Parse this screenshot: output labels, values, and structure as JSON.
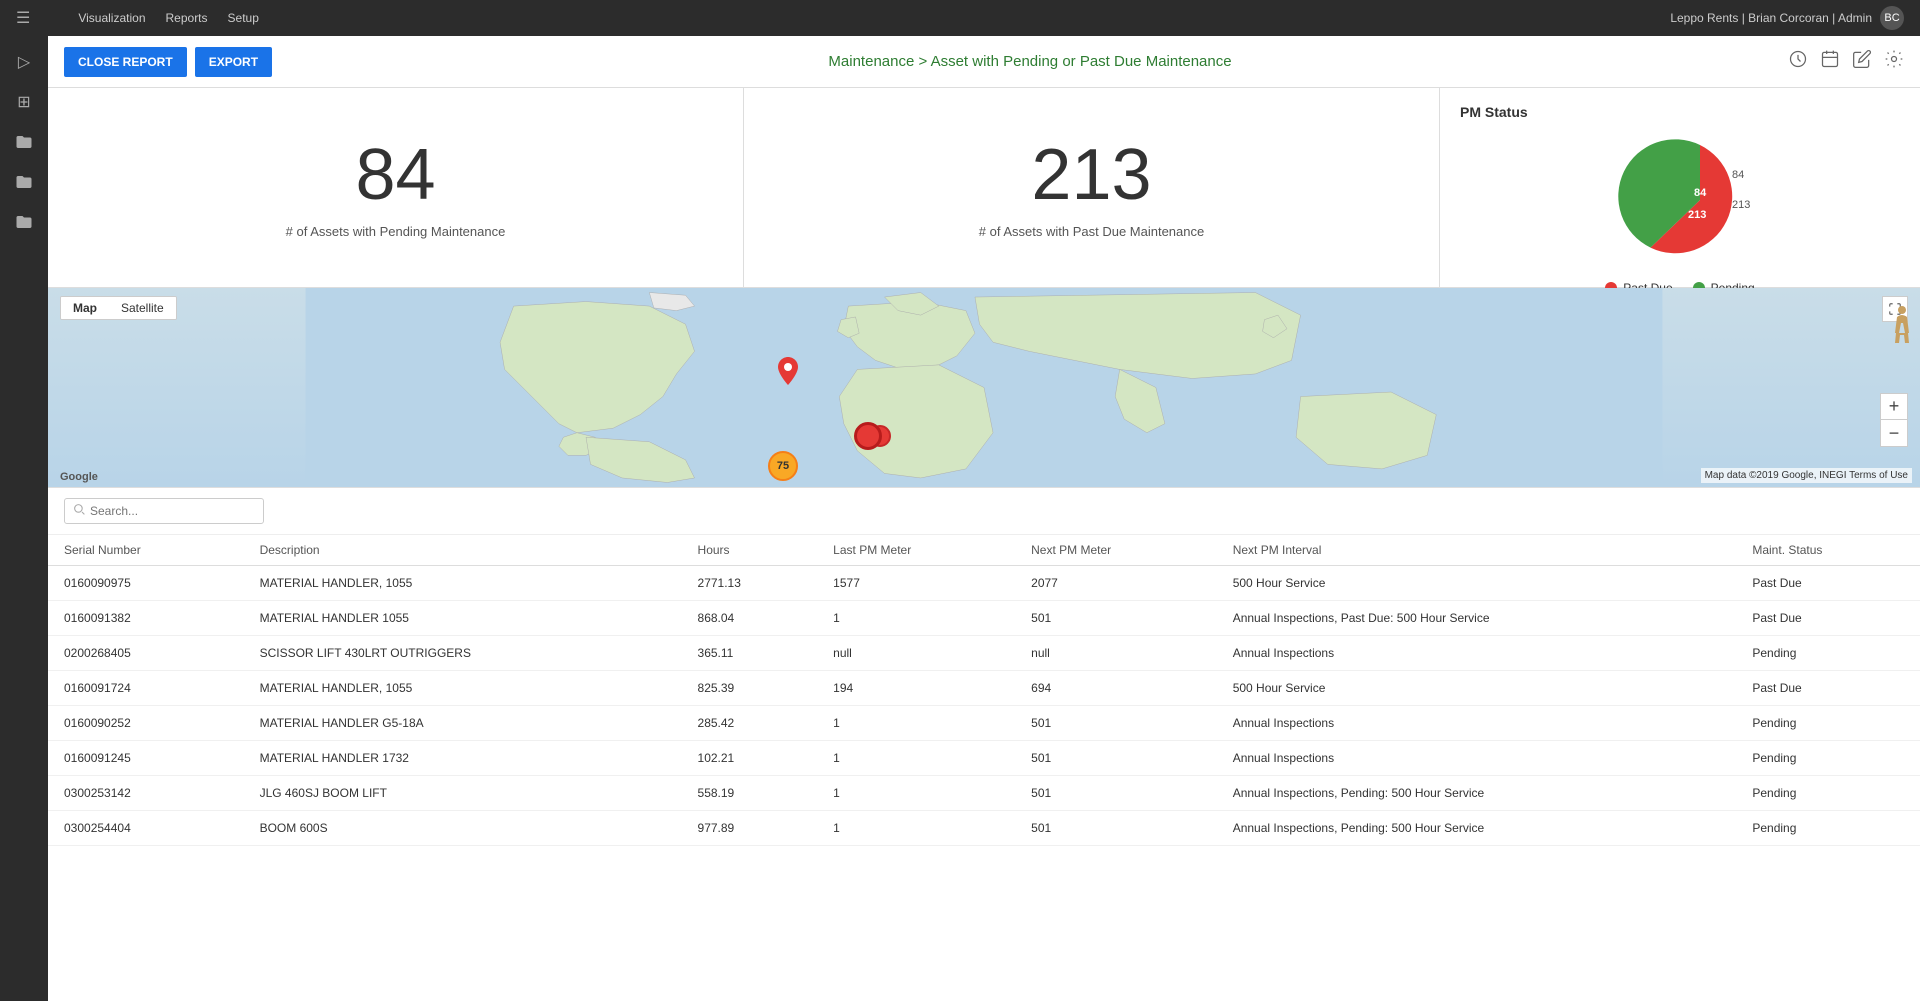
{
  "topnav": {
    "menu_icon": "≡",
    "items": [
      "Visualization",
      "Reports",
      "Setup"
    ],
    "user": "Leppo Rents | Brian Corcoran | Admin",
    "avatar_initials": "BC"
  },
  "sidebar": {
    "icons": [
      {
        "name": "expand-icon",
        "symbol": "▷"
      },
      {
        "name": "layers-icon",
        "symbol": "⊞"
      },
      {
        "name": "folder-open-icon",
        "symbol": "📁"
      },
      {
        "name": "folder-icon",
        "symbol": "📂"
      },
      {
        "name": "folder2-icon",
        "symbol": "📁"
      }
    ]
  },
  "header": {
    "close_report_label": "CLOSE REPORT",
    "export_label": "EXPORT",
    "report_title": "Maintenance > Asset with Pending or Past Due Maintenance"
  },
  "stats": {
    "pending_count": "84",
    "pending_label": "# of Assets with Pending Maintenance",
    "pastdue_count": "213",
    "pastdue_label": "# of Assets with Past Due Maintenance",
    "pm_status_title": "PM Status",
    "chart": {
      "pending_value": 84,
      "pastdue_value": 213,
      "pending_label": "84",
      "pastdue_label": "213",
      "legend_pastdue": "Past Due",
      "legend_pending": "Pending",
      "color_pastdue": "#e53935",
      "color_pending": "#43a047"
    }
  },
  "map": {
    "tab_map": "Map",
    "tab_satellite": "Satellite",
    "attribution": "Map data ©2019 Google, INEGI  Terms of Use",
    "google_logo": "Google"
  },
  "search": {
    "placeholder": "Search..."
  },
  "table": {
    "columns": [
      "Serial Number",
      "Description",
      "Hours",
      "Last PM Meter",
      "Next PM Meter",
      "Next PM Interval",
      "Maint. Status"
    ],
    "rows": [
      {
        "serial": "0160090975",
        "description": "MATERIAL HANDLER, 1055",
        "hours": "2771.13",
        "last_pm": "1577",
        "next_pm": "2077",
        "interval": "500 Hour Service",
        "status": "Past Due"
      },
      {
        "serial": "0160091382",
        "description": "MATERIAL HANDLER 1055",
        "hours": "868.04",
        "last_pm": "1",
        "next_pm": "501",
        "interval": "Annual Inspections, Past Due: 500 Hour Service",
        "status": "Past Due"
      },
      {
        "serial": "0200268405",
        "description": "SCISSOR LIFT 430LRT OUTRIGGERS",
        "hours": "365.11",
        "last_pm": "null",
        "next_pm": "null",
        "interval": "Annual Inspections",
        "status": "Pending"
      },
      {
        "serial": "0160091724",
        "description": "MATERIAL HANDLER, 1055",
        "hours": "825.39",
        "last_pm": "194",
        "next_pm": "694",
        "interval": "500 Hour Service",
        "status": "Past Due"
      },
      {
        "serial": "0160090252",
        "description": "MATERIAL HANDLER G5-18A",
        "hours": "285.42",
        "last_pm": "1",
        "next_pm": "501",
        "interval": "Annual Inspections",
        "status": "Pending"
      },
      {
        "serial": "0160091245",
        "description": "MATERIAL HANDLER 1732",
        "hours": "102.21",
        "last_pm": "1",
        "next_pm": "501",
        "interval": "Annual Inspections",
        "status": "Pending"
      },
      {
        "serial": "0300253142",
        "description": "JLG 460SJ BOOM LIFT",
        "hours": "558.19",
        "last_pm": "1",
        "next_pm": "501",
        "interval": "Annual Inspections, Pending: 500 Hour Service",
        "status": "Pending"
      },
      {
        "serial": "0300254404",
        "description": "BOOM 600S",
        "hours": "977.89",
        "last_pm": "1",
        "next_pm": "501",
        "interval": "Annual Inspections, Pending: 500 Hour Service",
        "status": "Pending"
      }
    ]
  }
}
